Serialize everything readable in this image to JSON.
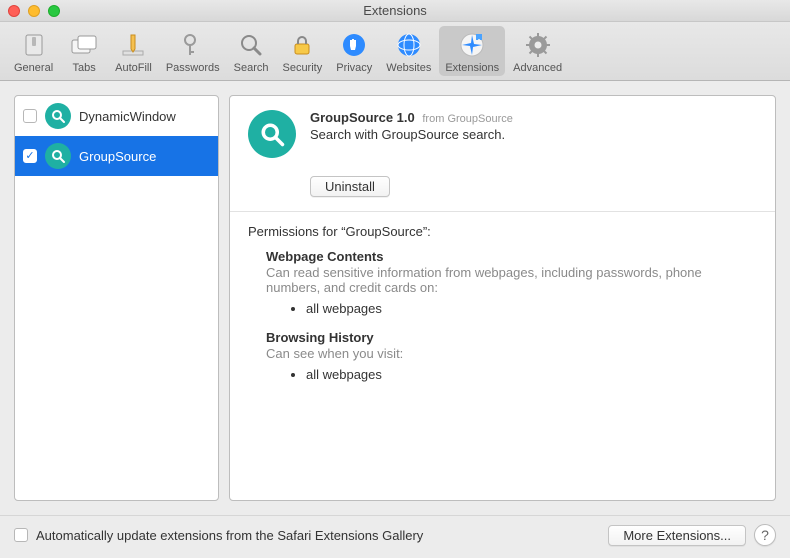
{
  "window": {
    "title": "Extensions"
  },
  "toolbar": {
    "items": [
      {
        "label": "General"
      },
      {
        "label": "Tabs"
      },
      {
        "label": "AutoFill"
      },
      {
        "label": "Passwords"
      },
      {
        "label": "Search"
      },
      {
        "label": "Security"
      },
      {
        "label": "Privacy"
      },
      {
        "label": "Websites"
      },
      {
        "label": "Extensions"
      },
      {
        "label": "Advanced"
      }
    ]
  },
  "sidebar": {
    "items": [
      {
        "label": "DynamicWindow",
        "checked": false,
        "selected": false
      },
      {
        "label": "GroupSource",
        "checked": true,
        "selected": true
      }
    ]
  },
  "detail": {
    "title": "GroupSource 1.0",
    "from_prefix": "from",
    "from_name": "GroupSource",
    "description": "Search with GroupSource search.",
    "uninstall_label": "Uninstall",
    "permissions_heading": "Permissions for “GroupSource”:",
    "sections": [
      {
        "title": "Webpage Contents",
        "desc": "Can read sensitive information from webpages, including passwords, phone numbers, and credit cards on:",
        "items": [
          "all webpages"
        ]
      },
      {
        "title": "Browsing History",
        "desc": "Can see when you visit:",
        "items": [
          "all webpages"
        ]
      }
    ]
  },
  "footer": {
    "auto_update_label": "Automatically update extensions from the Safari Extensions Gallery",
    "more_label": "More Extensions...",
    "help_label": "?"
  },
  "colors": {
    "extension_icon": "#1fb0a3",
    "selection": "#1773e6"
  }
}
